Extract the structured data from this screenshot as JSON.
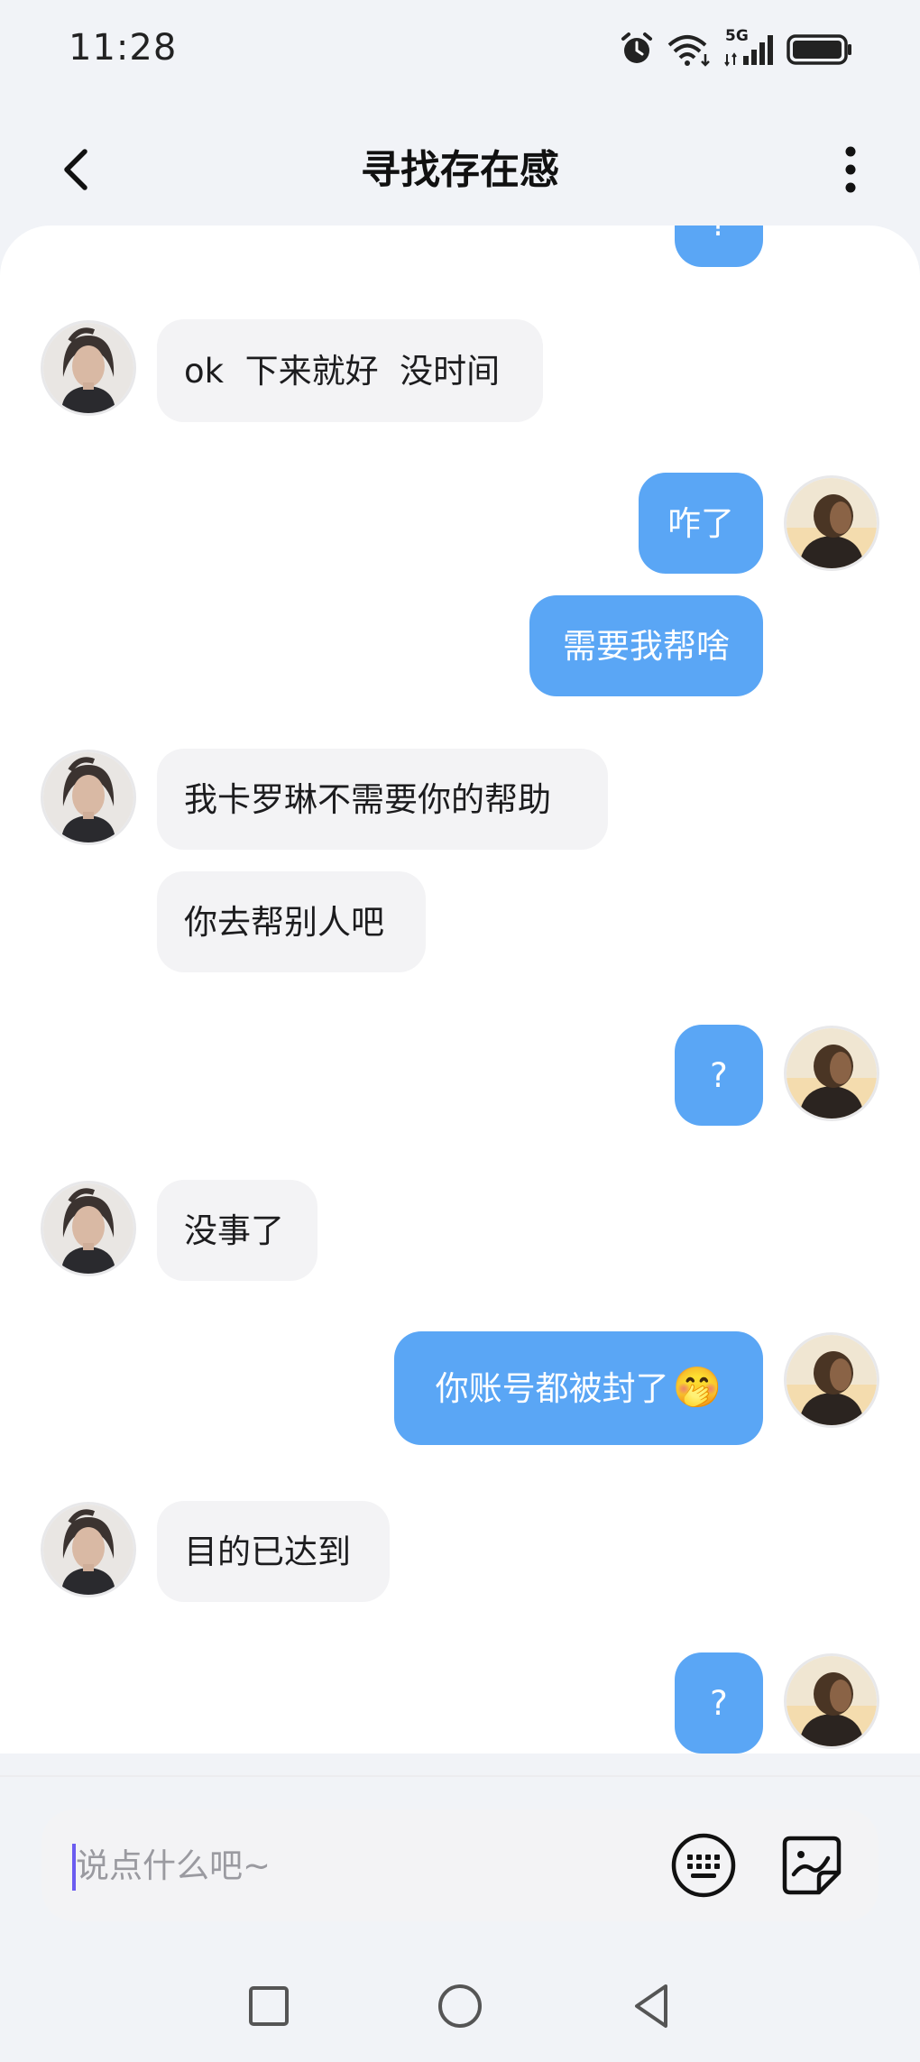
{
  "status_bar": {
    "time": "11:28",
    "network": "5G"
  },
  "header": {
    "title": "寻找存在感",
    "back_icon": "chevron-left-icon",
    "more_icon": "vertical-dots-icon"
  },
  "messages": [
    {
      "side": "right",
      "text": "?"
    },
    {
      "side": "left",
      "text": "ok  下来就好  没时间"
    },
    {
      "side": "right",
      "text": "咋了"
    },
    {
      "side": "right",
      "text": "需要我帮啥"
    },
    {
      "side": "left",
      "text": "我卡罗琳不需要你的帮助"
    },
    {
      "side": "left",
      "text": "你去帮别人吧"
    },
    {
      "side": "right",
      "text": "?"
    },
    {
      "side": "left",
      "text": "没事了"
    },
    {
      "side": "right",
      "text": "你账号都被封了",
      "emoji": "🤭"
    },
    {
      "side": "left",
      "text": "目的已达到"
    },
    {
      "side": "right",
      "text": "?"
    }
  ],
  "input": {
    "placeholder": "说点什么吧~"
  },
  "colors": {
    "bubble_right": "#5aa6f5",
    "bubble_left": "#f3f3f5",
    "background": "#f1f3f7"
  }
}
